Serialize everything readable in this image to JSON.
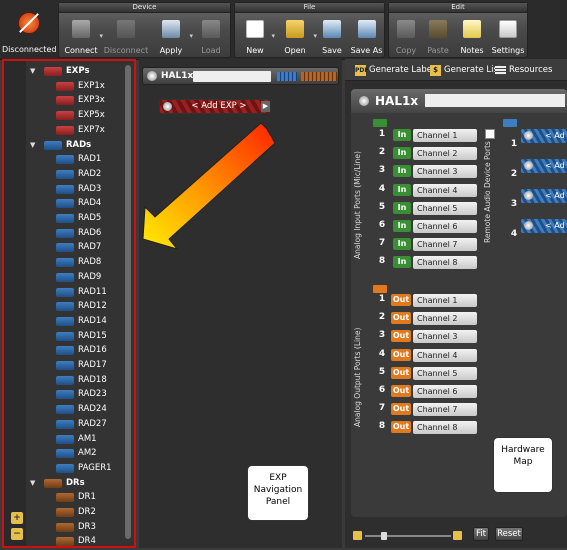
{
  "toolbar": {
    "status_label": "Disconnected",
    "groups": [
      {
        "title": "Device",
        "buttons": [
          "Connect",
          "Disconnect",
          "Apply",
          "Load"
        ]
      },
      {
        "title": "File",
        "buttons": [
          "New",
          "Open",
          "Save",
          "Save As"
        ]
      },
      {
        "title": "Edit",
        "buttons": [
          "Copy",
          "Paste",
          "Notes",
          "Settings"
        ]
      }
    ]
  },
  "nav": {
    "groups": [
      {
        "label": "EXPs",
        "items": [
          "EXP1x",
          "EXP3x",
          "EXP5x",
          "EXP7x"
        ]
      },
      {
        "label": "RADs",
        "items": [
          "RAD1",
          "RAD2",
          "RAD3",
          "RAD4",
          "RAD5",
          "RAD6",
          "RAD7",
          "RAD8",
          "RAD9",
          "RAD11",
          "RAD12",
          "RAD14",
          "RAD15",
          "RAD16",
          "RAD17",
          "RAD18",
          "RAD23",
          "RAD24",
          "RAD27",
          "AM1",
          "AM2",
          "PAGER1"
        ]
      },
      {
        "label": "DRs",
        "items": [
          "DR1",
          "DR2",
          "DR3",
          "DR4"
        ]
      }
    ],
    "zoom_in": "+",
    "zoom_out": "−"
  },
  "mid": {
    "device_label": "HAL1x",
    "add_exp": "< Add EXP >",
    "callout": "EXP\nNavigation\nPanel"
  },
  "right": {
    "toolbar": {
      "gen_labels": "Generate Labels",
      "gen_list": "Generate List",
      "resources": "Resources"
    },
    "device_label": "HAL1x",
    "analog_in_label": "Analog Input Ports (Mic/Line)",
    "analog_out_label": "Analog Output Ports (Line)",
    "remote_label": "Remote Audio Device Ports",
    "in_tag": "In",
    "out_tag": "Out",
    "channels": [
      "Channel 1",
      "Channel 2",
      "Channel 3",
      "Channel 4",
      "Channel 5",
      "Channel 6",
      "Channel 7",
      "Channel 8"
    ],
    "numbers": [
      "1",
      "2",
      "3",
      "4",
      "5",
      "6",
      "7",
      "8"
    ],
    "remote_numbers": [
      "1",
      "2",
      "3",
      "4"
    ],
    "remote_add": "< Ad",
    "callout": "Hardware\nMap",
    "fit": "Fit",
    "reset": "Reset"
  }
}
